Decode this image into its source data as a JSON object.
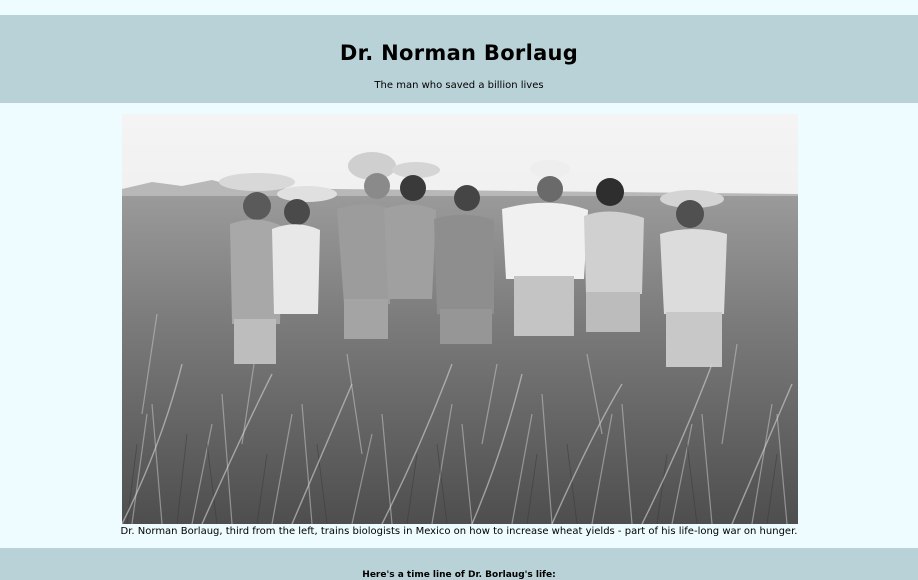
{
  "header": {
    "title": "Dr. Norman Borlaug",
    "tagline": "The man who saved a billion lives"
  },
  "figure": {
    "caption": "Dr. Norman Borlaug, third from the left, trains biologists in Mexico on how to increase wheat yields - part of his life-long war on hunger."
  },
  "timeline": {
    "heading": "Here's a time line of Dr. Borlaug's life:"
  }
}
